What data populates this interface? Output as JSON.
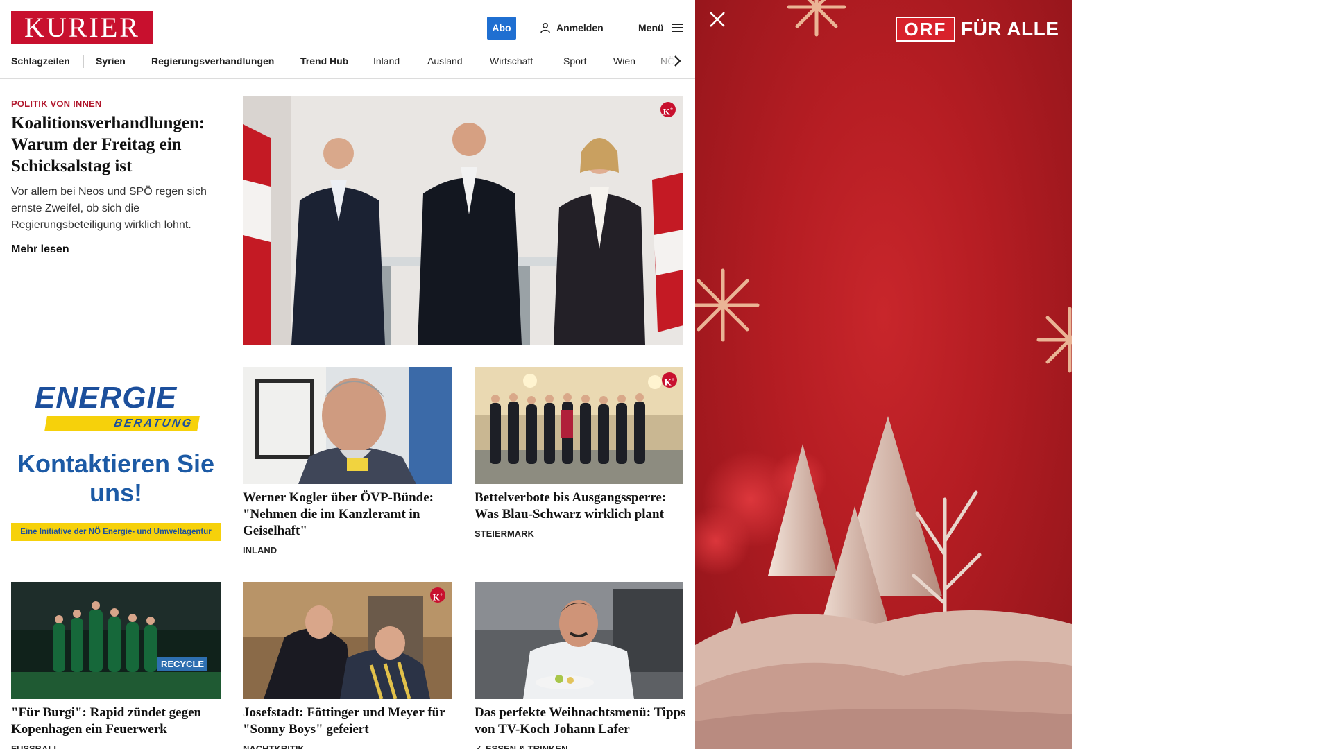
{
  "site": {
    "logo": "KURIER",
    "abo_label": "Abo",
    "login_label": "Anmelden",
    "menu_label": "Menü"
  },
  "nav": {
    "items": [
      "Schlagzeilen",
      "Syrien",
      "Regierungsverhandlungen",
      "Trend Hub",
      "Inland",
      "Ausland",
      "Wirtschaft",
      "Sport",
      "Wien",
      "NÖ"
    ]
  },
  "hero": {
    "kicker": "POLITIK VON INNEN",
    "title": "Koalitionsverhandlungen: Warum der Freitag ein Schicksalstag ist",
    "teaser": "Vor allem bei Neos und SPÖ regen sich ernste Zweifel, ob sich die Regierungsbeteiligung wirklich lohnt.",
    "more": "Mehr lesen"
  },
  "ad": {
    "brand": "ENERGIE",
    "brand_sub": "BERATUNG",
    "cta": "Kontaktieren Sie uns!",
    "foot": "Eine Initiative der NÖ Energie- und Umweltagentur"
  },
  "cards": [
    {
      "title": "Werner Kogler über ÖVP-Bünde: \"Nehmen die im Kanzleramt in Geiselhaft\"",
      "category": "INLAND"
    },
    {
      "title": "Bettelverbote bis Ausgangssperre: Was Blau-Schwarz wirklich plant",
      "category": "STEIERMARK"
    },
    {
      "title": "\"Für Burgi\": Rapid zündet gegen Kopenhagen ein Feuerwerk",
      "category": "FUSSBALL"
    },
    {
      "title": "Josefstadt: Föttinger und Meyer für \"Sonny Boys\" gefeiert",
      "category": "NACHTKRITIK"
    },
    {
      "title": "Das perfekte Weihnachtsmenü: Tipps von TV-Koch Johann Lafer",
      "category": "ESSEN & TRINKEN"
    }
  ],
  "image_text": {
    "recycle": "RECYCLE"
  },
  "orf": {
    "logo_box": "ORF",
    "logo_text": "FÜR ALLE"
  }
}
